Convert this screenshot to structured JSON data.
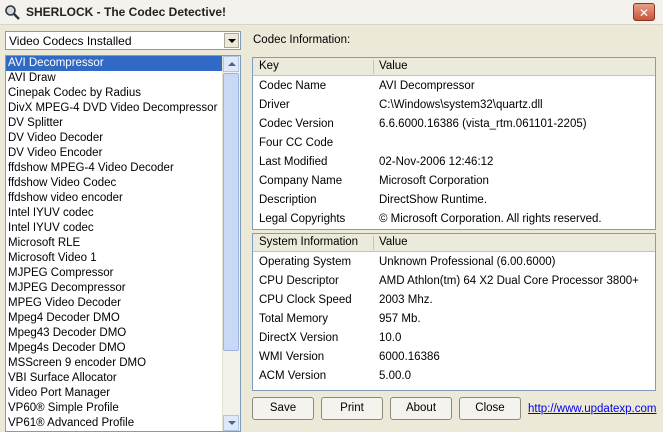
{
  "window": {
    "title": "SHERLOCK - The Codec Detective!"
  },
  "dropdown": {
    "selected": "Video Codecs Installed"
  },
  "codec_list": {
    "items": [
      "AVI Decompressor",
      "AVI Draw",
      "Cinepak Codec by Radius",
      "DivX MPEG-4 DVD Video Decompressor",
      "DV Splitter",
      "DV Video Decoder",
      "DV Video Encoder",
      "ffdshow MPEG-4 Video Decoder",
      "ffdshow Video Codec",
      "ffdshow video encoder",
      "Intel IYUV codec",
      "Intel IYUV codec",
      "Microsoft RLE",
      "Microsoft Video 1",
      "MJPEG Compressor",
      "MJPEG Decompressor",
      "MPEG Video Decoder",
      "Mpeg4 Decoder DMO",
      "Mpeg43 Decoder DMO",
      "Mpeg4s Decoder DMO",
      "MSScreen 9 encoder DMO",
      "VBI Surface Allocator",
      "Video Port Manager",
      "VP60® Simple Profile",
      "VP61® Advanced Profile"
    ],
    "selected_index": 0
  },
  "codec_info": {
    "label": "Codec Information:",
    "headers": {
      "key": "Key",
      "value": "Value"
    },
    "rows": [
      {
        "key": "Codec Name",
        "value": "AVI Decompressor"
      },
      {
        "key": "Driver",
        "value": "C:\\Windows\\system32\\quartz.dll"
      },
      {
        "key": "Codec Version",
        "value": "6.6.6000.16386 (vista_rtm.061101-2205)"
      },
      {
        "key": "Four CC Code",
        "value": ""
      },
      {
        "key": "Last Modified",
        "value": "02-Nov-2006 12:46:12"
      },
      {
        "key": "Company Name",
        "value": "Microsoft Corporation"
      },
      {
        "key": "Description",
        "value": "DirectShow Runtime."
      },
      {
        "key": "Legal Copyrights",
        "value": "© Microsoft Corporation. All rights reserved."
      }
    ]
  },
  "system_info": {
    "headers": {
      "key": "System Information",
      "value": "Value"
    },
    "rows": [
      {
        "key": "Operating System",
        "value": "Unknown Professional (6.00.6000)"
      },
      {
        "key": "CPU Descriptor",
        "value": "AMD Athlon(tm) 64 X2 Dual Core Processor 3800+"
      },
      {
        "key": "CPU Clock Speed",
        "value": "2003 Mhz."
      },
      {
        "key": "Total Memory",
        "value": "957 Mb."
      },
      {
        "key": "DirectX Version",
        "value": "10.0"
      },
      {
        "key": "WMI Version",
        "value": "6000.16386"
      },
      {
        "key": "ACM Version",
        "value": "5.00.0"
      }
    ]
  },
  "buttons": {
    "save": "Save",
    "print": "Print",
    "about": "About",
    "close": "Close"
  },
  "link": {
    "text": "http://www.updatexp.com"
  }
}
